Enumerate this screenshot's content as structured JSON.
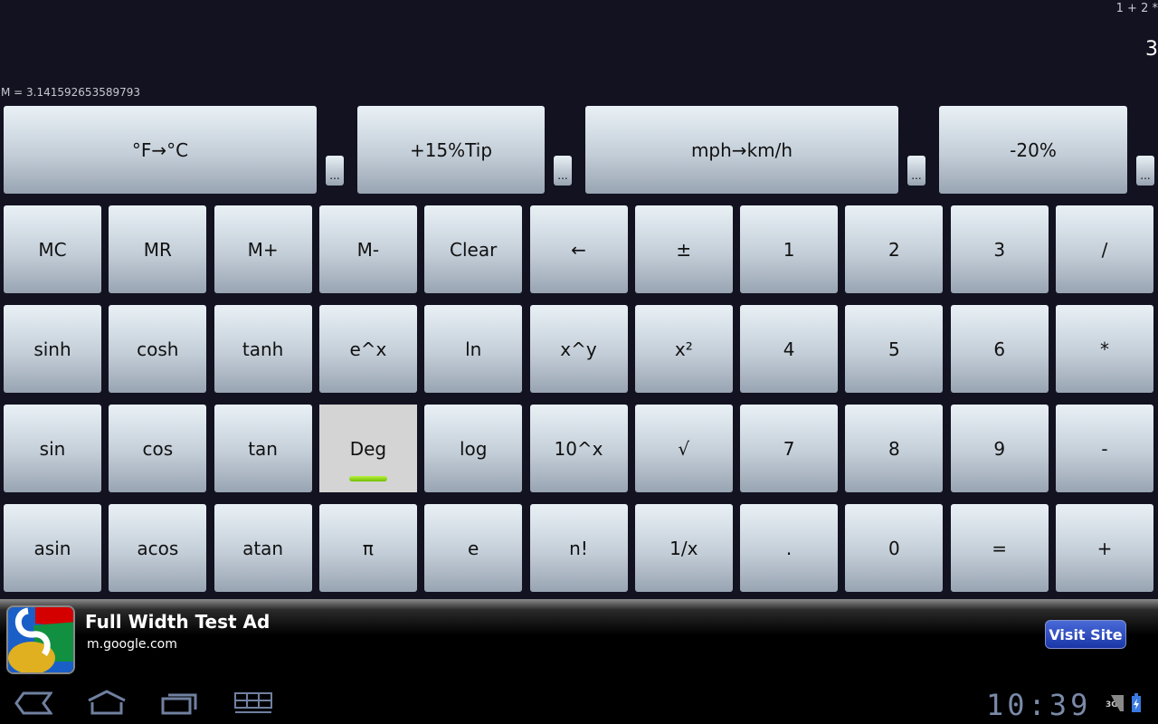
{
  "display": {
    "expression": "1 + 2 *",
    "result": "3",
    "memory": "M = 3.141592653589793"
  },
  "custom_buttons": [
    {
      "label": "°F→°C",
      "more": "..."
    },
    {
      "label": "+15%Tip",
      "more": "..."
    },
    {
      "label": "mph→km/h",
      "more": "..."
    },
    {
      "label": "-20%",
      "more": "..."
    }
  ],
  "keypad": [
    [
      "MC",
      "MR",
      "M+",
      "M-",
      "Clear",
      "←",
      "±",
      "1",
      "2",
      "3",
      "/"
    ],
    [
      "sinh",
      "cosh",
      "tanh",
      "e^x",
      "ln",
      "x^y",
      "x²",
      "4",
      "5",
      "6",
      "*"
    ],
    [
      "sin",
      "cos",
      "tan",
      "Deg",
      "log",
      "10^x",
      "√",
      "7",
      "8",
      "9",
      "-"
    ],
    [
      "asin",
      "acos",
      "atan",
      "π",
      "e",
      "n!",
      "1/x",
      ".",
      "0",
      "=",
      "+"
    ]
  ],
  "deg_mode_active": true,
  "ad": {
    "title": "Full Width Test Ad",
    "url": "m.google.com",
    "button": "Visit Site"
  },
  "status": {
    "time": "10:39",
    "network": "3G"
  },
  "colors": {
    "background": "#121221",
    "ad_button": "#1a36a8",
    "indicator": "#8ee020"
  }
}
